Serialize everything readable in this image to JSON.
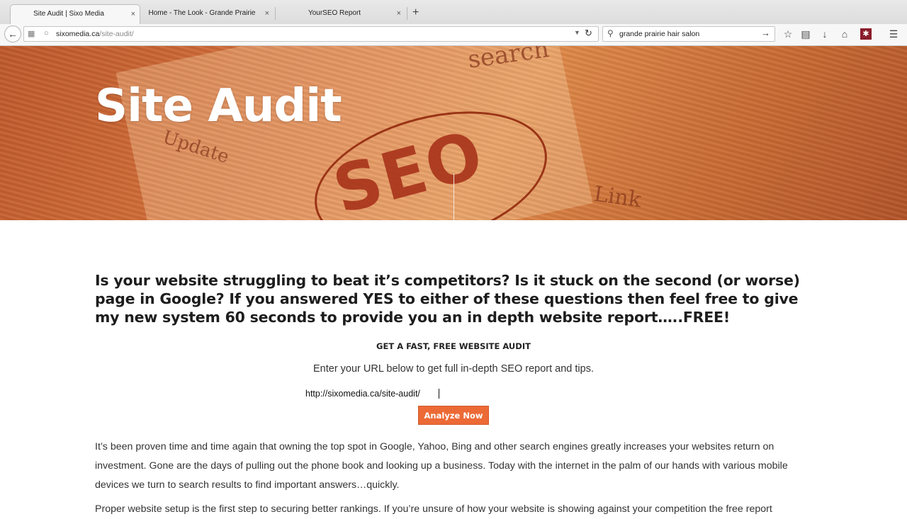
{
  "browser": {
    "tabs": [
      {
        "label": "Site Audit | Sixo Media",
        "active": true
      },
      {
        "label": "Home - The Look - Grande Prairie",
        "active": false
      },
      {
        "label": "YourSEO Report",
        "active": false
      }
    ],
    "new_tab_label": "+",
    "close_glyph": "×",
    "url_host": "sixomedia.ca",
    "url_path": "/site-audit/",
    "search_text": "grande prairie hair salon",
    "toolbar_icons": [
      "star-icon",
      "reading-list-icon",
      "download-icon",
      "home-icon",
      "extension-icon",
      "menu-icon"
    ]
  },
  "hero": {
    "title": "Site Audit",
    "background_words": {
      "seo": "SEO",
      "update": "Update",
      "link": "Link",
      "search": "search"
    }
  },
  "content": {
    "headline": "Is your website struggling to beat it’s competitors? Is it stuck on the second (or worse) page in Google? If you answered YES to either of these questions then feel free to give my new system 60 seconds to provide you an in depth website report…..FREE!",
    "section_label": "GET A FAST, FREE WEBSITE AUDIT",
    "subtitle": "Enter your URL below to get full in-depth SEO report and tips.",
    "url_value": "http://sixomedia.ca/site-audit/",
    "button_label": "Analyze Now",
    "paragraph": "It’s been proven time and time again that owning the top spot in Google, Yahoo, Bing and other search engines greatly increases your websites return on investment. Gone are the days of pulling out the phone book and looking up a business. Today with the internet in the palm of our hands with various mobile devices we turn to search results to find important answers…quickly.",
    "paragraph_2_partial": "Proper website setup is the first step to securing better rankings. If you’re unsure of how your website is showing against your competition the free report"
  },
  "colors": {
    "accent": "#ec6a36",
    "hero": "#d8743e",
    "text": "#1d1d1d"
  }
}
